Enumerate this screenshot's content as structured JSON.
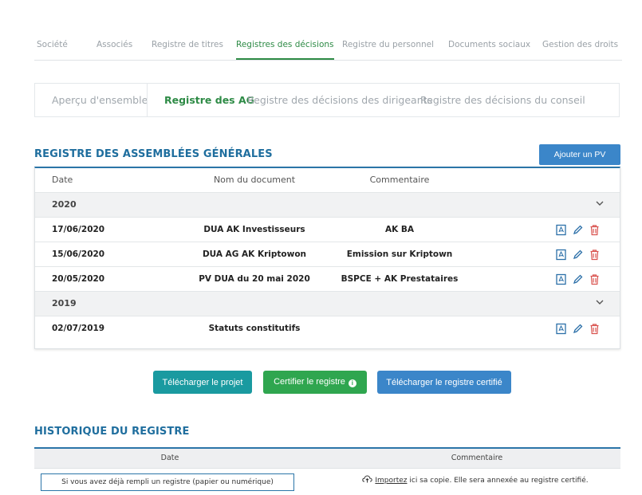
{
  "main_tabs": [
    {
      "label": "Société",
      "active": false
    },
    {
      "label": "Associés",
      "active": false
    },
    {
      "label": "Registre de titres",
      "active": false
    },
    {
      "label": "Registres des décisions",
      "active": true
    },
    {
      "label": "Registre du personnel",
      "active": false
    },
    {
      "label": "Documents sociaux",
      "active": false
    },
    {
      "label": "Gestion des droits",
      "active": false
    }
  ],
  "sub_tabs": [
    {
      "label": "Aperçu d'ensemble",
      "active": false
    },
    {
      "label": "Registre des AG",
      "active": true
    },
    {
      "label": "Registre des décisions des dirigeants",
      "active": false
    },
    {
      "label": "Registre des décisions du conseil",
      "active": false
    }
  ],
  "ag_section": {
    "title": "REGISTRE DES ASSEMBLÉES GÉNÉRALES",
    "add_button": "Ajouter un PV",
    "columns": [
      "Date",
      "Nom du document",
      "Commentaire"
    ],
    "groups": [
      {
        "year": "2020",
        "rows": [
          {
            "date": "17/06/2020",
            "name": "DUA AK Investisseurs",
            "comment": "AK BA"
          },
          {
            "date": "15/06/2020",
            "name": "DUA AG AK Kriptowon",
            "comment": "Emission sur Kriptown"
          },
          {
            "date": "20/05/2020",
            "name": "PV DUA du 20 mai 2020",
            "comment": "BSPCE + AK Prestataires"
          }
        ]
      },
      {
        "year": "2019",
        "rows": [
          {
            "date": "02/07/2019",
            "name": "Statuts constitutifs",
            "comment": ""
          }
        ]
      }
    ]
  },
  "actions": {
    "download_project": "Télécharger le projet",
    "certify": "Certifier le registre",
    "download_certified": "Télécharger le registre certifié"
  },
  "history": {
    "title": "HISTORIQUE DU REGISTRE",
    "columns": [
      "Date",
      "Commentaire"
    ],
    "box_text": "Si vous avez déjà rempli un registre (papier ou numérique)",
    "import_link": "Importez",
    "import_rest": "ici sa copie. Elle sera annexée au registre certifié."
  },
  "colors": {
    "accent_green": "#2e8b46",
    "title_blue": "#1f6e9e",
    "button_blue": "#3b86c9",
    "button_teal": "#1a9aa0",
    "button_green": "#2fa64f",
    "delete_red": "#d9534f"
  },
  "icons": {
    "row_actions": [
      "pdf-icon",
      "pencil-icon",
      "trash-icon"
    ],
    "year_toggle": "chevron-down-icon",
    "info": "info-icon",
    "upload": "cloud-upload-icon"
  }
}
